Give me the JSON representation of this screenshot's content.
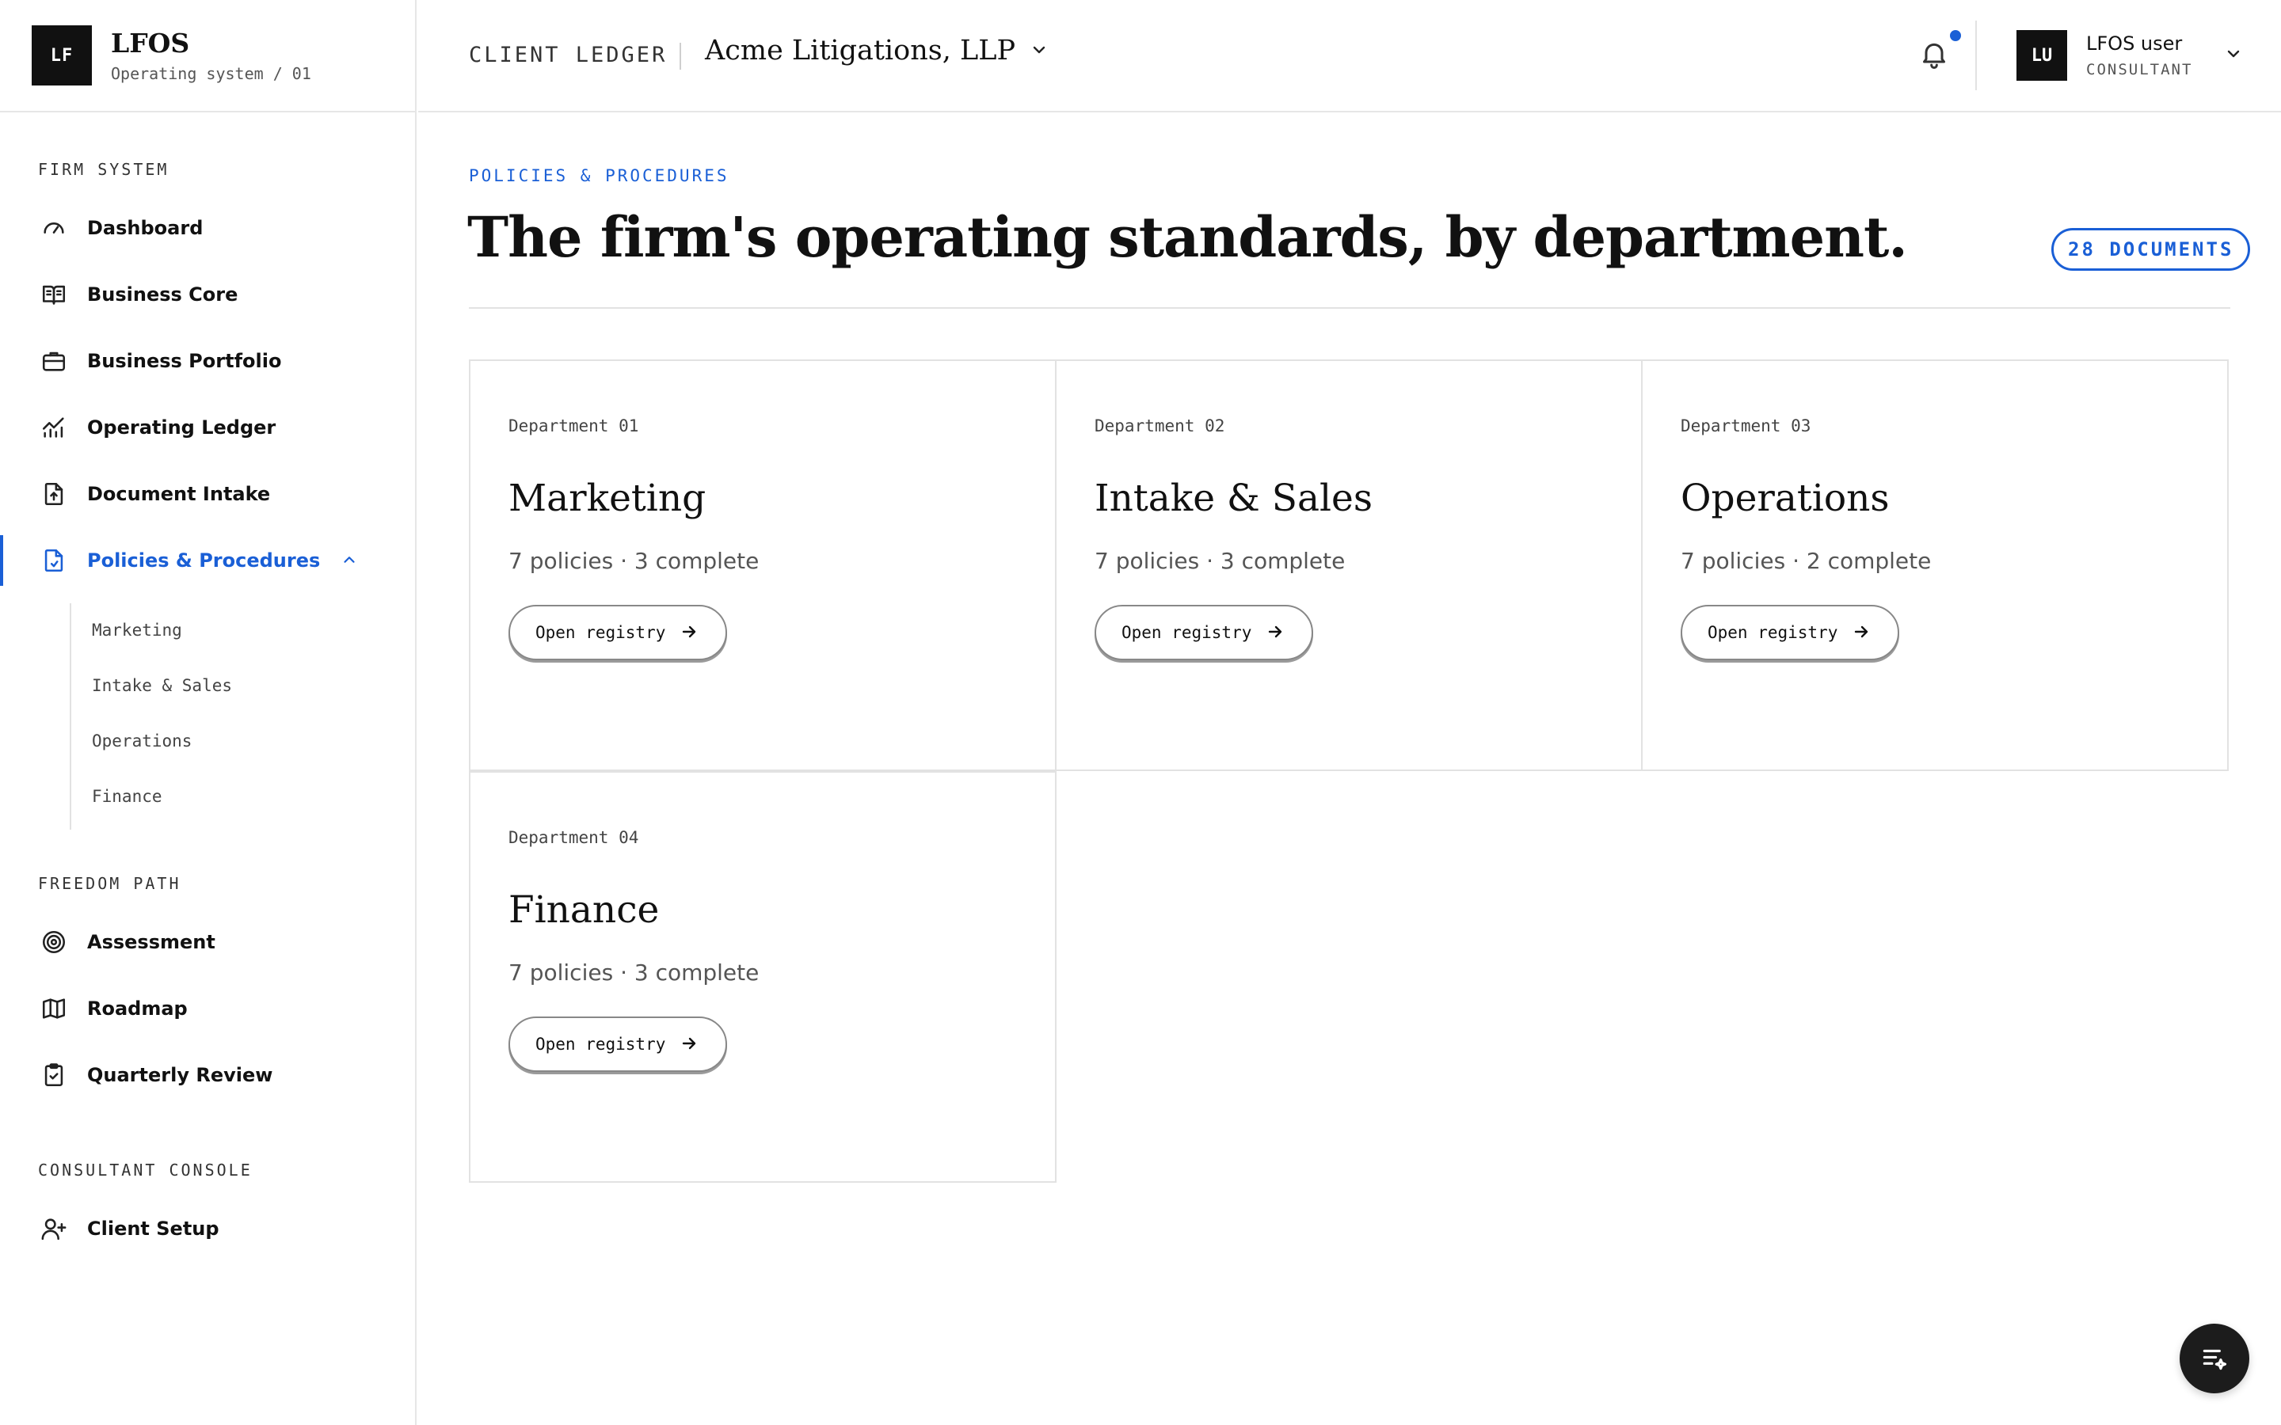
{
  "brand": {
    "mark": "LF",
    "title": "LFOS",
    "subtitle": "Operating system / 01"
  },
  "topbar": {
    "ledger_label": "CLIENT LEDGER",
    "client_name": "Acme Litigations, LLP",
    "user": {
      "initials": "LU",
      "name": "LFOS user",
      "role": "CONSULTANT"
    },
    "notification_dot_color": "#1a5fd6"
  },
  "sidebar": {
    "sections": [
      {
        "title": "FIRM SYSTEM"
      },
      {
        "title": "FREEDOM PATH"
      },
      {
        "title": "CONSULTANT CONSOLE"
      }
    ],
    "items": [
      {
        "label": "Dashboard",
        "icon": "gauge-icon"
      },
      {
        "label": "Business Core",
        "icon": "book-open-icon"
      },
      {
        "label": "Business Portfolio",
        "icon": "briefcase-icon"
      },
      {
        "label": "Operating Ledger",
        "icon": "chart-line-icon"
      },
      {
        "label": "Document Intake",
        "icon": "file-upload-icon"
      },
      {
        "label": "Policies & Procedures",
        "icon": "file-check-icon",
        "active": true,
        "expanded": true
      },
      {
        "label": "Assessment",
        "icon": "target-icon"
      },
      {
        "label": "Roadmap",
        "icon": "map-icon"
      },
      {
        "label": "Quarterly Review",
        "icon": "clipboard-check-icon"
      },
      {
        "label": "Client Setup",
        "icon": "user-plus-icon"
      }
    ],
    "subitems": [
      "Marketing",
      "Intake & Sales",
      "Operations",
      "Finance"
    ]
  },
  "main": {
    "eyebrow": "POLICIES & PROCEDURES",
    "title": "The firm's operating standards, by department.",
    "badge": "28 DOCUMENTS",
    "accent_color": "#1a5fd6",
    "departments": [
      {
        "dept": "Department 01",
        "name": "Marketing",
        "meta": "7 policies · 3 complete",
        "button": "Open registry"
      },
      {
        "dept": "Department 02",
        "name": "Intake & Sales",
        "meta": "7 policies · 3 complete",
        "button": "Open registry"
      },
      {
        "dept": "Department 03",
        "name": "Operations",
        "meta": "7 policies · 2 complete",
        "button": "Open registry"
      },
      {
        "dept": "Department 04",
        "name": "Finance",
        "meta": "7 policies · 3 complete",
        "button": "Open registry"
      }
    ]
  },
  "fab": {
    "icon": "list-sparkle-icon"
  }
}
